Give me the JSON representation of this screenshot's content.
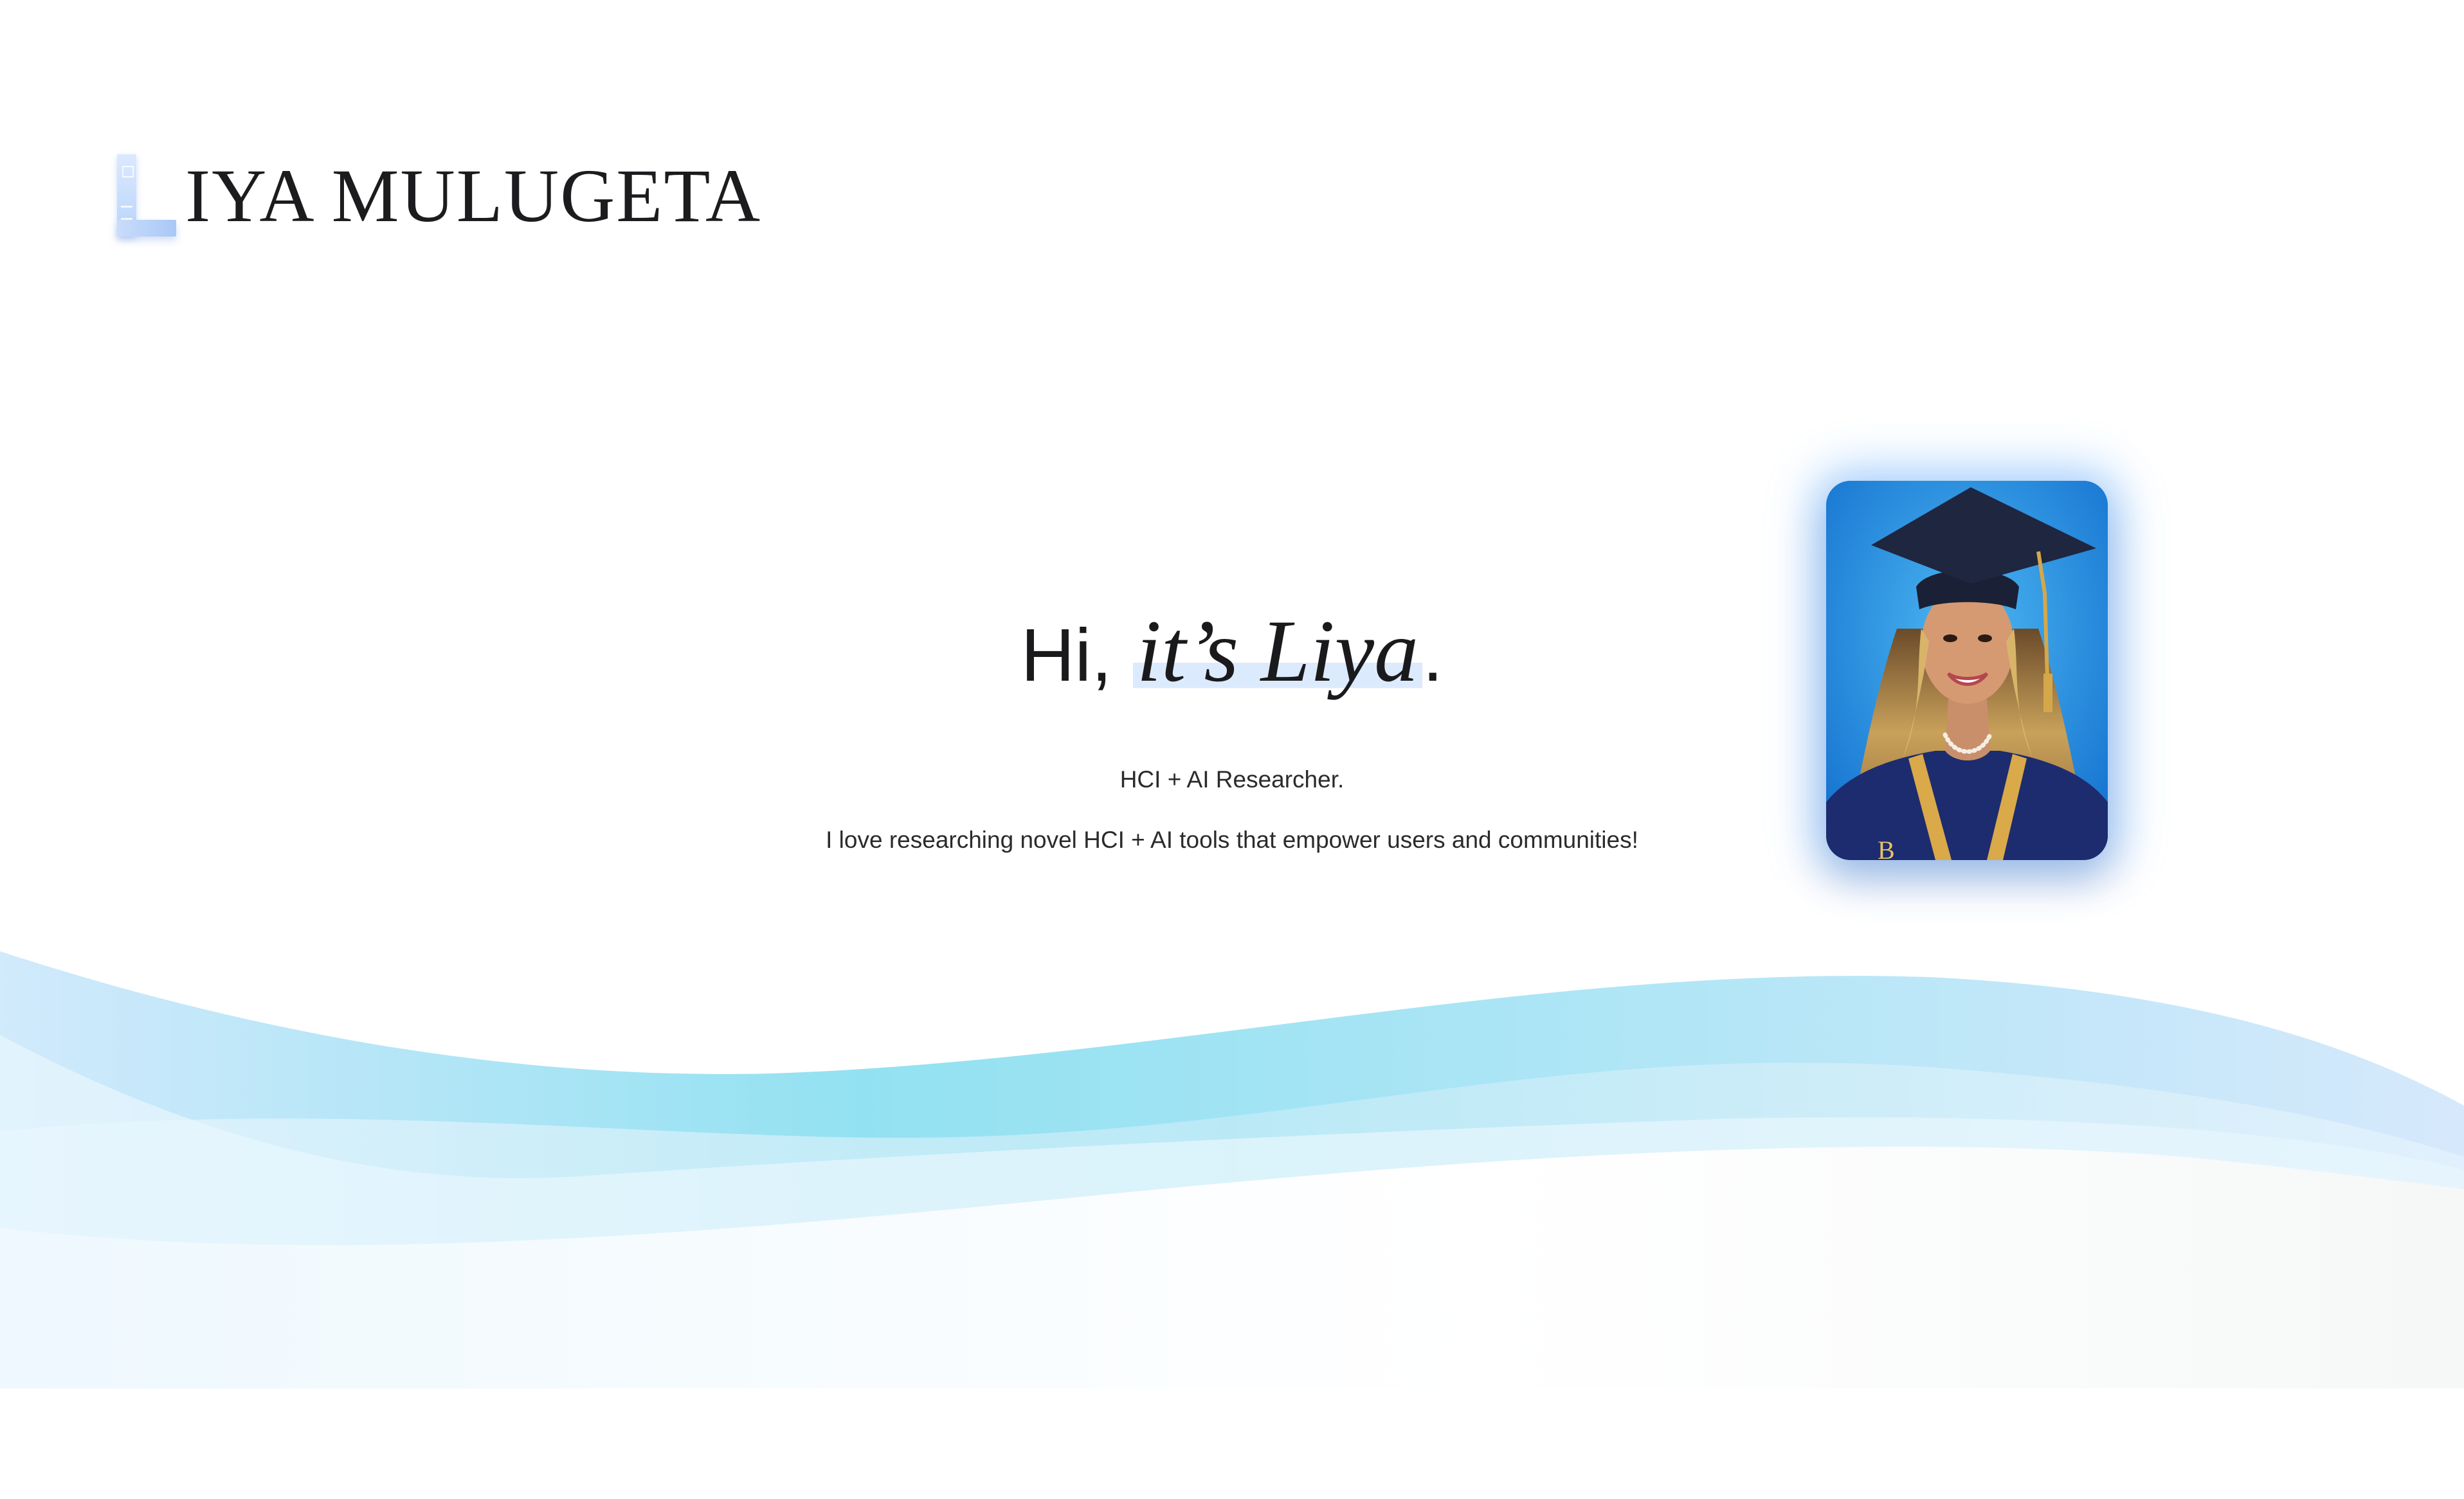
{
  "header": {
    "logo_initial": "L",
    "logo_rest": "IYA MULUGETA"
  },
  "hero": {
    "greeting_prefix": "Hi, ",
    "greeting_name": "it’s Liya",
    "greeting_suffix": ".",
    "role": "HCI + AI Researcher.",
    "tagline": "I love researching novel HCI + AI tools that empower users and communities!"
  },
  "portrait": {
    "alt": "Portrait of Liya Mulugeta in graduation cap and gown"
  },
  "colors": {
    "accent_light": "#dceafd",
    "wave_teal": "#7fdcef",
    "wave_light": "#cdeefa",
    "text": "#1a1a1d",
    "portrait_bg": "#2a93e4"
  }
}
